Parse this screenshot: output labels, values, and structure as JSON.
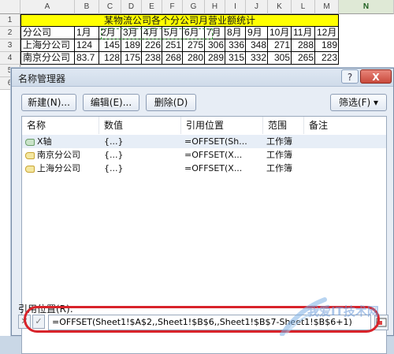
{
  "sheet": {
    "columns": [
      "A",
      "B",
      "C",
      "D",
      "E",
      "F",
      "G",
      "H",
      "I",
      "J",
      "K",
      "L",
      "M",
      "N"
    ],
    "row_numbers": [
      "1",
      "2",
      "3",
      "4",
      "5",
      "6"
    ],
    "title": "某物流公司各个分公司月营业额统计",
    "header_row": [
      "分公司",
      "1月",
      "2月",
      "3月",
      "4月",
      "5月",
      "6月",
      "7月",
      "8月",
      "9月",
      "10月",
      "11月",
      "12月"
    ],
    "rows": [
      [
        "上海分公司",
        "124",
        "145",
        "189",
        "226",
        "251",
        "275",
        "306",
        "336",
        "348",
        "271",
        "288",
        "189"
      ],
      [
        "南京分公司",
        "83.7",
        "128",
        "175",
        "238",
        "268",
        "280",
        "289",
        "315",
        "332",
        "305",
        "265",
        "223"
      ]
    ]
  },
  "dialog": {
    "title": "名称管理器",
    "help_label": "?",
    "close_label": "X",
    "buttons": {
      "new": "新建(N)...",
      "edit": "编辑(E)...",
      "delete": "删除(D)",
      "filter": "筛选(F) ▾"
    },
    "list": {
      "headers": [
        "名称",
        "数值",
        "引用位置",
        "范围",
        "备注"
      ],
      "items": [
        {
          "name": "X轴",
          "value": "{...}",
          "ref": "=OFFSET(Sh...",
          "scope": "工作簿",
          "icon": "green-name-icon"
        },
        {
          "name": "南京分公司",
          "value": "{...}",
          "ref": "=OFFSET(X...",
          "scope": "工作簿",
          "icon": "yellow-name-icon"
        },
        {
          "name": "上海分公司",
          "value": "{...}",
          "ref": "=OFFSET(X...",
          "scope": "工作簿",
          "icon": "yellow-name-icon"
        }
      ]
    },
    "ref_label": "引用位置(R):",
    "ref_value": "=OFFSET(Sheet1!$A$2,,Sheet1!$B$6,,Sheet1!$B$7-Sheet1!$B$6+1)",
    "cancel_mark": "✕",
    "confirm_mark": "✓"
  },
  "watermark": "我爱IT技术网",
  "colors": {
    "title_fill": "#ffff00",
    "highlight_oval": "#d8232a",
    "dialog_bg": "#e7edf5"
  }
}
